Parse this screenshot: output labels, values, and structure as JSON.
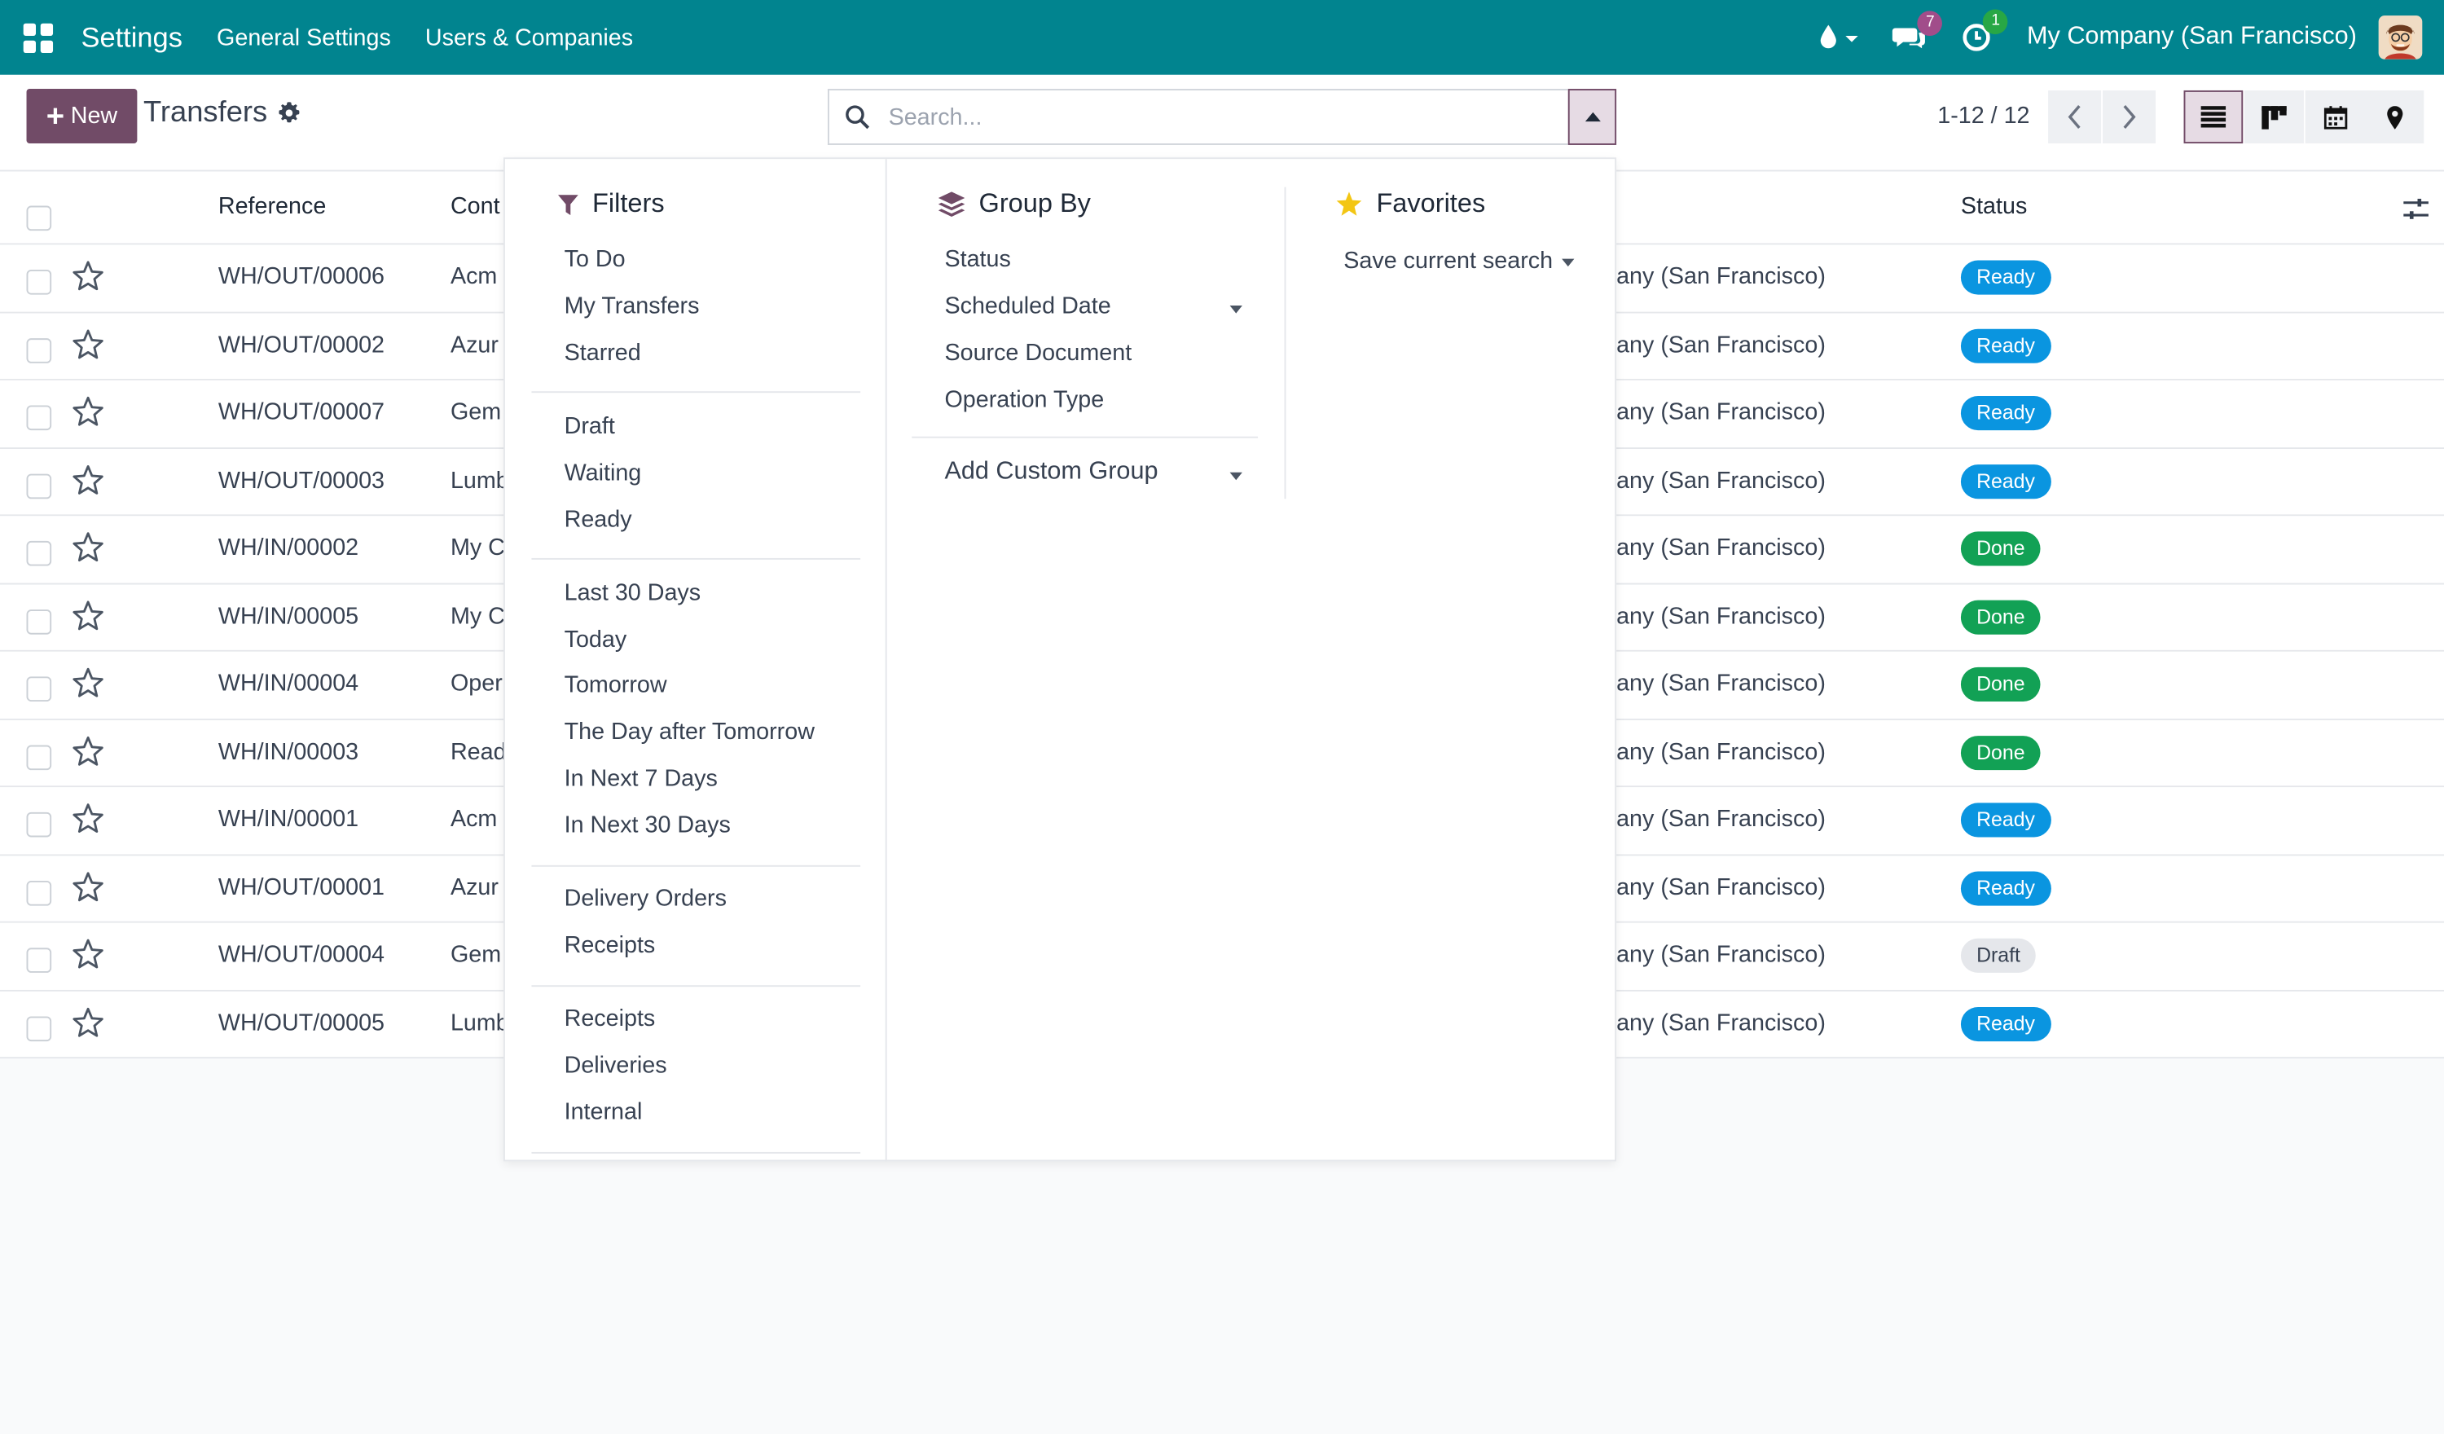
{
  "navbar": {
    "app_name": "Settings",
    "menus": [
      "General Settings",
      "Users & Companies"
    ],
    "messages_count": "7",
    "activities_count": "1",
    "company": "My Company (San Francisco)"
  },
  "control": {
    "new_label": "New",
    "title": "Transfers",
    "search_placeholder": "Search...",
    "pager": "1-12 / 12"
  },
  "list": {
    "headers": {
      "reference": "Reference",
      "contact": "Cont",
      "status": "Status"
    },
    "rows": [
      {
        "ref": "WH/OUT/00006",
        "contact": "Acm",
        "company": "any (San Francisco)",
        "status": "Ready"
      },
      {
        "ref": "WH/OUT/00002",
        "contact": "Azur",
        "company": "any (San Francisco)",
        "status": "Ready"
      },
      {
        "ref": "WH/OUT/00007",
        "contact": "Gem",
        "company": "any (San Francisco)",
        "status": "Ready"
      },
      {
        "ref": "WH/OUT/00003",
        "contact": "Lumb",
        "company": "any (San Francisco)",
        "status": "Ready"
      },
      {
        "ref": "WH/IN/00002",
        "contact": "My C",
        "company": "any (San Francisco)",
        "status": "Done"
      },
      {
        "ref": "WH/IN/00005",
        "contact": "My C",
        "company": "any (San Francisco)",
        "status": "Done"
      },
      {
        "ref": "WH/IN/00004",
        "contact": "Oper",
        "company": "any (San Francisco)",
        "status": "Done"
      },
      {
        "ref": "WH/IN/00003",
        "contact": "Read",
        "company": "any (San Francisco)",
        "status": "Done"
      },
      {
        "ref": "WH/IN/00001",
        "contact": "Acm",
        "company": "any (San Francisco)",
        "status": "Ready"
      },
      {
        "ref": "WH/OUT/00001",
        "contact": "Azur",
        "company": "any (San Francisco)",
        "status": "Ready"
      },
      {
        "ref": "WH/OUT/00004",
        "contact": "Gem",
        "company": "any (San Francisco)",
        "status": "Draft"
      },
      {
        "ref": "WH/OUT/00005",
        "contact": "Lumb",
        "company": "any (San Francisco)",
        "status": "Ready"
      }
    ]
  },
  "dropdown": {
    "filters": {
      "title": "Filters",
      "groups": [
        [
          "To Do",
          "My Transfers",
          "Starred"
        ],
        [
          "Draft",
          "Waiting",
          "Ready"
        ],
        [
          "Last 30 Days",
          "Today",
          "Tomorrow",
          "The Day after Tomorrow",
          "In Next 7 Days",
          "In Next 30 Days"
        ],
        [
          "Delivery Orders",
          "Receipts"
        ],
        [
          "Receipts",
          "Deliveries",
          "Internal"
        ]
      ]
    },
    "groupby": {
      "title": "Group By",
      "items": [
        "Status",
        "Scheduled Date",
        "Source Document",
        "Operation Type"
      ],
      "custom": "Add Custom Group"
    },
    "favorites": {
      "title": "Favorites",
      "save_search": "Save current search"
    }
  },
  "colors": {
    "navbar": "#01848f",
    "primary": "#714b67",
    "ready": "#0a95e0",
    "done": "#12a155",
    "draft": "#e5e7eb"
  }
}
